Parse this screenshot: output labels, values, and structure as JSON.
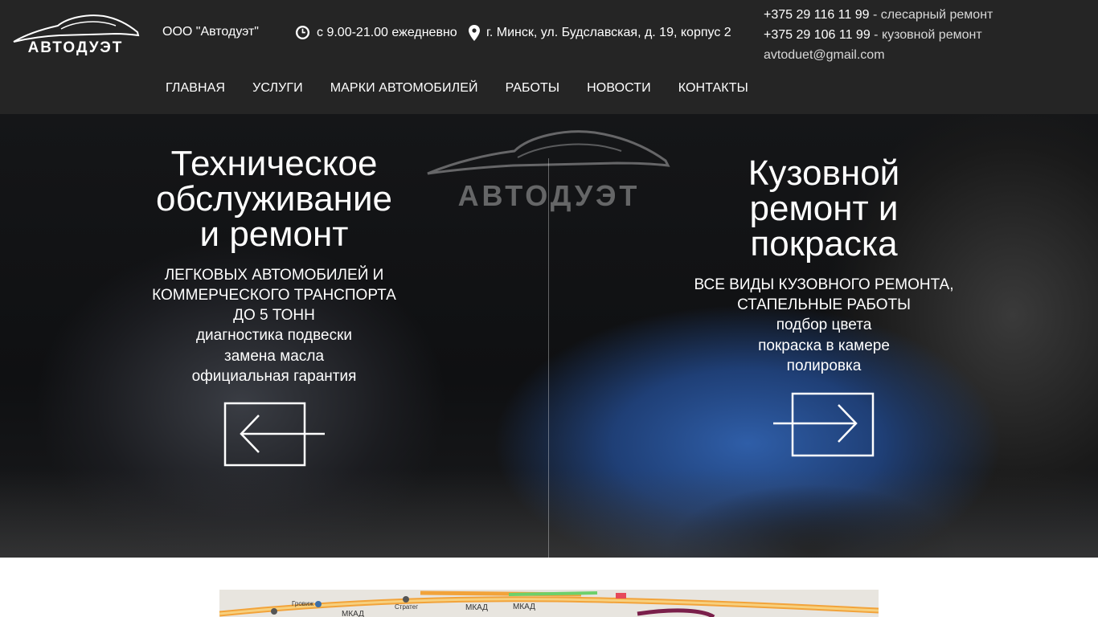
{
  "header": {
    "logo_text": "АВТОДУЭТ",
    "company": "ООО \"Автодуэт\"",
    "hours": "с 9.00-21.00 ежедневно",
    "address": "г. Минск, ул. Будславская, д. 19, корпус 2",
    "phone1": "+375 29 116 11 99",
    "phone1_desc": " - слесарный ремонт",
    "phone2": "+375 29 106 11 99",
    "phone2_desc": " - кузовной ремонт",
    "email": "avtoduet@gmail.com",
    "icons": {
      "hours": "clock-icon",
      "address": "location-pin-icon"
    }
  },
  "nav": {
    "items": [
      {
        "label": "ГЛАВНАЯ"
      },
      {
        "label": "УСЛУГИ"
      },
      {
        "label": "МАРКИ АВТОМОБИЛЕЙ"
      },
      {
        "label": "РАБОТЫ"
      },
      {
        "label": "НОВОСТИ"
      },
      {
        "label": "КОНТАКТЫ"
      }
    ]
  },
  "hero": {
    "watermark_text": "АВТОДУЭТ",
    "left": {
      "title": [
        "Техническое",
        "обслуживание",
        "и ремонт"
      ],
      "subtitle": [
        "ЛЕГКОВЫХ АВТОМОБИЛЕЙ И",
        "КОММЕРЧЕСКОГО ТРАНСПОРТА",
        "ДО 5 ТОНН"
      ],
      "bullets": [
        "диагностика подвески",
        "замена масла",
        "официальная гарантия"
      ],
      "arrow_icon": "arrow-left-icon"
    },
    "right": {
      "title": [
        "Кузовной",
        "ремонт и",
        "покраска"
      ],
      "subtitle": [
        "ВСЕ ВИДЫ КУЗОВНОГО РЕМОНТА,",
        "СТАПЕЛЬНЫЕ РАБОТЫ"
      ],
      "bullets": [
        "подбор цвета",
        "покраска в камере",
        "полировка"
      ],
      "arrow_icon": "arrow-right-icon"
    }
  },
  "map": {
    "labels": [
      "МКАД",
      "МКАД",
      "МКАД",
      "Стратег",
      "Гровиж"
    ]
  },
  "colors": {
    "header_bg": "#252525",
    "accent_blue": "#2f5ea8"
  }
}
